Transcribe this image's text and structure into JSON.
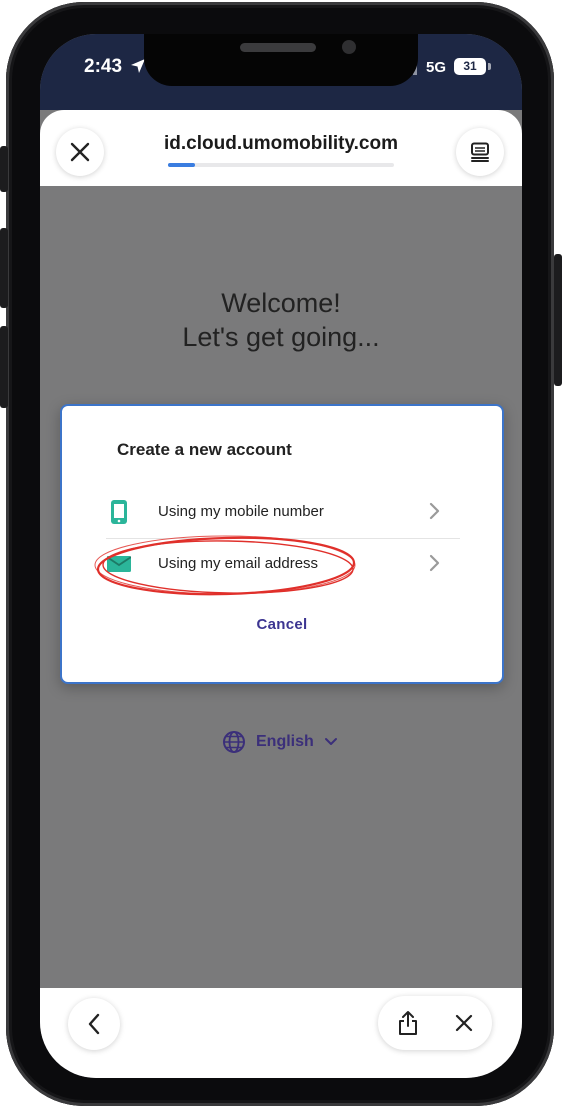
{
  "status_bar": {
    "time": "2:43",
    "network": "5G",
    "battery": "31"
  },
  "browser": {
    "url": "id.cloud.umomobility.com",
    "load_progress": 0.12
  },
  "page": {
    "welcome_line1": "Welcome!",
    "welcome_line2": "Let's get going..."
  },
  "dialog": {
    "title": "Create a new account",
    "options": [
      {
        "label": "Using my mobile number",
        "icon": "mobile-phone-icon"
      },
      {
        "label": "Using my email address",
        "icon": "envelope-icon"
      }
    ],
    "cancel_label": "Cancel"
  },
  "language": {
    "label": "English",
    "icon": "globe-icon"
  },
  "colors": {
    "status_bar_bg": "#1d2744",
    "accent_purple": "#3c3591",
    "icon_teal": "#2bb59a",
    "annotation_red": "#e0302b"
  }
}
